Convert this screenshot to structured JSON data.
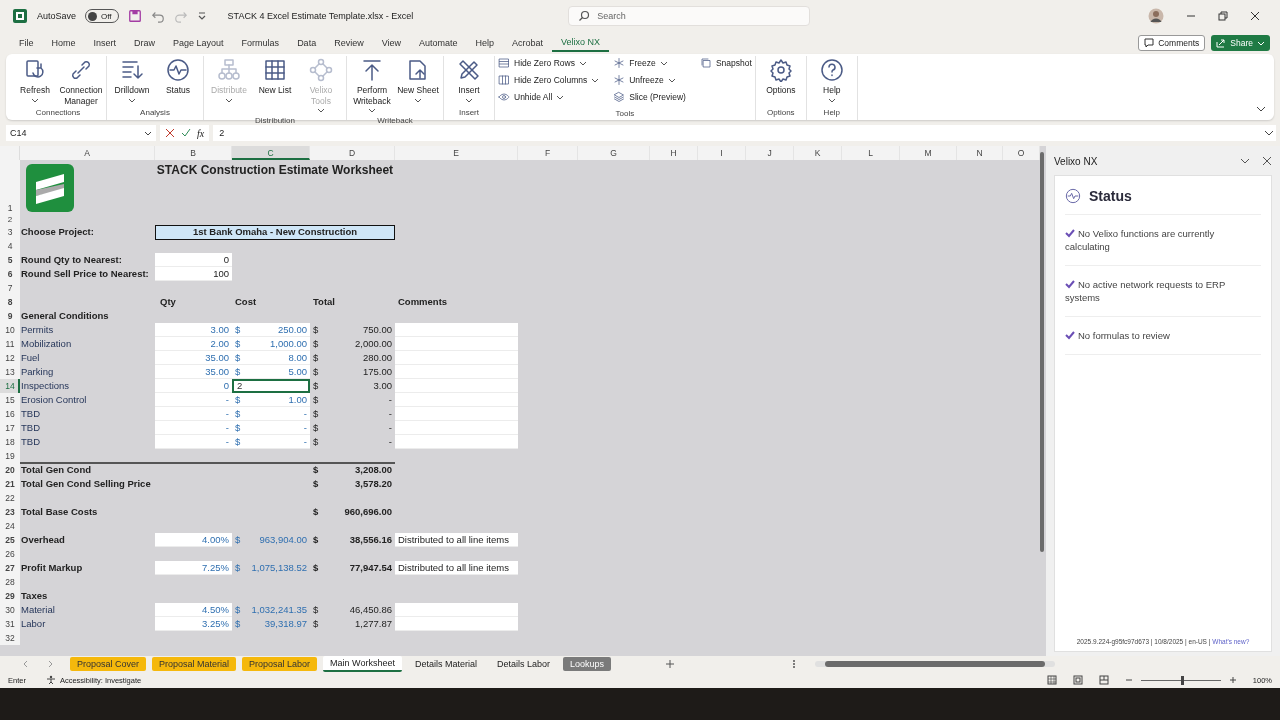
{
  "title_bar": {
    "autosave_label": "AutoSave",
    "autosave": {
      "label": "Off",
      "on": false
    },
    "document_title": "STACK 4 Excel Estimate Template.xlsx  -  Excel",
    "search": {
      "placeholder": "Search"
    }
  },
  "menu_tabs": [
    {
      "label": "File",
      "selected": false
    },
    {
      "label": "Home",
      "selected": false
    },
    {
      "label": "Insert",
      "selected": false
    },
    {
      "label": "Draw",
      "selected": false
    },
    {
      "label": "Page Layout",
      "selected": false
    },
    {
      "label": "Formulas",
      "selected": false
    },
    {
      "label": "Data",
      "selected": false
    },
    {
      "label": "Review",
      "selected": false
    },
    {
      "label": "View",
      "selected": false
    },
    {
      "label": "Automate",
      "selected": false
    },
    {
      "label": "Help",
      "selected": false
    },
    {
      "label": "Acrobat",
      "selected": false
    },
    {
      "label": "Velixo NX",
      "selected": true
    }
  ],
  "actions": {
    "comments": "Comments",
    "share": "Share"
  },
  "ribbon_groups": [
    {
      "label": "Connections",
      "items": [
        {
          "label": "Refresh",
          "kind": "large",
          "dropdown": true,
          "disabled": false
        },
        {
          "label": "Connection Manager",
          "kind": "large",
          "dropdown": false,
          "disabled": false
        }
      ]
    },
    {
      "label": "Analysis",
      "items": [
        {
          "label": "Drilldown",
          "kind": "large",
          "dropdown": true,
          "disabled": false
        },
        {
          "label": "Status",
          "kind": "large",
          "dropdown": false,
          "disabled": false
        }
      ]
    },
    {
      "label": "Distribution",
      "items": [
        {
          "label": "Distribute",
          "kind": "large",
          "dropdown": true,
          "disabled": true
        },
        {
          "label": "New List",
          "kind": "large",
          "dropdown": false,
          "disabled": false
        },
        {
          "label": "Velixo Tools",
          "kind": "large",
          "dropdown": true,
          "disabled": true
        }
      ]
    },
    {
      "label": "Writeback",
      "items": [
        {
          "label": "Perform Writeback",
          "kind": "large",
          "dropdown": true,
          "disabled": false
        },
        {
          "label": "New Sheet",
          "kind": "large",
          "dropdown": true,
          "disabled": false
        }
      ]
    },
    {
      "label": "Insert",
      "items": [
        {
          "label": "Insert",
          "kind": "large",
          "dropdown": true,
          "disabled": false
        }
      ]
    },
    {
      "label": "Tools",
      "items": [
        {
          "label": "Hide Zero Rows",
          "kind": "small",
          "dropdown": true,
          "disabled": false
        },
        {
          "label": "Hide Zero Columns",
          "kind": "small",
          "dropdown": true,
          "disabled": false
        },
        {
          "label": "Unhide All",
          "kind": "small",
          "dropdown": true,
          "disabled": false
        },
        {
          "label": "Freeze",
          "kind": "small",
          "dropdown": true,
          "disabled": false
        },
        {
          "label": "Unfreeze",
          "kind": "small",
          "dropdown": true,
          "disabled": false
        },
        {
          "label": "Slice (Preview)",
          "kind": "small",
          "dropdown": false,
          "disabled": false
        },
        {
          "label": "Snapshot",
          "kind": "small",
          "dropdown": false,
          "disabled": false
        }
      ]
    },
    {
      "label": "Options",
      "items": [
        {
          "label": "Options",
          "kind": "large",
          "dropdown": false,
          "disabled": false
        }
      ]
    },
    {
      "label": "Help",
      "items": [
        {
          "label": "Help",
          "kind": "large",
          "dropdown": true,
          "disabled": false
        }
      ]
    }
  ],
  "formula_bar": {
    "name_box": "C14",
    "function_label": "fx",
    "formula": "2"
  },
  "sheet": {
    "columns": [
      {
        "label": "A",
        "selected": false
      },
      {
        "label": "B",
        "selected": false
      },
      {
        "label": "C",
        "selected": true
      },
      {
        "label": "D",
        "selected": false
      },
      {
        "label": "E",
        "selected": false
      },
      {
        "label": "F",
        "selected": false
      },
      {
        "label": "G",
        "selected": false
      },
      {
        "label": "H",
        "selected": false
      },
      {
        "label": "I",
        "selected": false
      },
      {
        "label": "J",
        "selected": false
      },
      {
        "label": "K",
        "selected": false
      },
      {
        "label": "L",
        "selected": false
      },
      {
        "label": "M",
        "selected": false
      },
      {
        "label": "N",
        "selected": false
      },
      {
        "label": "O",
        "selected": false
      }
    ],
    "rows": [
      {
        "num": "1",
        "selected": false,
        "kind": "logo-title",
        "title": "STACK Construction Estimate Worksheet"
      },
      {
        "num": "2",
        "selected": false,
        "kind": "spacer"
      },
      {
        "num": "3",
        "selected": false,
        "kind": "project",
        "label": "Choose Project:",
        "project": "1st Bank Omaha - New Construction"
      },
      {
        "num": "4",
        "selected": false,
        "kind": "blank"
      },
      {
        "num": "5",
        "selected": false,
        "kind": "setting",
        "label": "Round Qty to Nearest:",
        "qty": "0"
      },
      {
        "num": "6",
        "selected": false,
        "kind": "setting",
        "label": "Round Sell Price to Nearest:",
        "qty": "100"
      },
      {
        "num": "7",
        "selected": false,
        "kind": "blank"
      },
      {
        "num": "8",
        "selected": false,
        "kind": "header",
        "qty_heading": "Qty",
        "cost_heading": "Cost",
        "total_heading": "Total",
        "comment_heading": "Comments"
      },
      {
        "num": "9",
        "selected": false,
        "kind": "section",
        "label": "General Conditions"
      },
      {
        "num": "10",
        "selected": false,
        "kind": "item",
        "label": "Permits",
        "qty": "3.00",
        "cost_cur": "$",
        "cost": "250.00",
        "total_cur": "$",
        "total": "750.00"
      },
      {
        "num": "11",
        "selected": false,
        "kind": "item",
        "label": "Mobilization",
        "qty": "2.00",
        "cost_cur": "$",
        "cost": "1,000.00",
        "total_cur": "$",
        "total": "2,000.00"
      },
      {
        "num": "12",
        "selected": false,
        "kind": "item",
        "label": "Fuel",
        "qty": "35.00",
        "cost_cur": "$",
        "cost": "8.00",
        "total_cur": "$",
        "total": "280.00"
      },
      {
        "num": "13",
        "selected": false,
        "kind": "item",
        "label": "Parking",
        "qty": "35.00",
        "cost_cur": "$",
        "cost": "5.00",
        "total_cur": "$",
        "total": "175.00"
      },
      {
        "num": "14",
        "selected": true,
        "kind": "item",
        "editing": true,
        "label": "Inspections",
        "qty": "0",
        "entry": "2",
        "total_cur": "$",
        "total": "3.00"
      },
      {
        "num": "15",
        "selected": false,
        "kind": "item",
        "label": "Erosion Control",
        "qty": "-",
        "cost_cur": "$",
        "cost": "1.00",
        "total_cur": "$",
        "total": "-"
      },
      {
        "num": "16",
        "selected": false,
        "kind": "item",
        "label": "TBD",
        "qty": "-",
        "cost_cur": "$",
        "cost": "-",
        "total_cur": "$",
        "total": "-"
      },
      {
        "num": "17",
        "selected": false,
        "kind": "item",
        "label": "TBD",
        "qty": "-",
        "cost_cur": "$",
        "cost": "-",
        "total_cur": "$",
        "total": "-"
      },
      {
        "num": "18",
        "selected": false,
        "kind": "item",
        "label": "TBD",
        "qty": "-",
        "cost_cur": "$",
        "cost": "-",
        "total_cur": "$",
        "total": "-"
      },
      {
        "num": "19",
        "selected": false,
        "kind": "blank"
      },
      {
        "num": "20",
        "selected": false,
        "kind": "total",
        "rule_above": true,
        "label": "Total Gen Cond",
        "total_cur": "$",
        "total": "3,208.00"
      },
      {
        "num": "21",
        "selected": false,
        "kind": "total",
        "label": "Total Gen Cond Selling Price",
        "total_cur": "$",
        "total": "3,578.20"
      },
      {
        "num": "22",
        "selected": false,
        "kind": "blank"
      },
      {
        "num": "23",
        "selected": false,
        "kind": "total",
        "label": "Total Base Costs",
        "total_cur": "$",
        "total": "960,696.00"
      },
      {
        "num": "24",
        "selected": false,
        "kind": "blank"
      },
      {
        "num": "25",
        "selected": false,
        "kind": "rate",
        "label": "Overhead",
        "qty": "4.00%",
        "cost_cur": "$",
        "cost": "963,904.00",
        "total_cur": "$",
        "total": "38,556.16",
        "comment": "Distributed to all line items"
      },
      {
        "num": "26",
        "selected": false,
        "kind": "blank"
      },
      {
        "num": "27",
        "selected": false,
        "kind": "rate",
        "label": "Profit Markup",
        "qty": "7.25%",
        "cost_cur": "$",
        "cost": "1,075,138.52",
        "total_cur": "$",
        "total": "77,947.54",
        "comment": "Distributed to all line items"
      },
      {
        "num": "28",
        "selected": false,
        "kind": "blank"
      },
      {
        "num": "29",
        "selected": false,
        "kind": "section",
        "label": "Taxes"
      },
      {
        "num": "30",
        "selected": false,
        "kind": "tax",
        "label": "Material",
        "qty": "4.50%",
        "cost_cur": "$",
        "cost": "1,032,241.35",
        "total_cur": "$",
        "total": "46,450.86"
      },
      {
        "num": "31",
        "selected": false,
        "kind": "tax",
        "label": "Labor",
        "qty": "3.25%",
        "cost_cur": "$",
        "cost": "39,318.97",
        "total_cur": "$",
        "total": "1,277.87"
      },
      {
        "num": "32",
        "selected": false,
        "kind": "blank"
      }
    ]
  },
  "sheet_tabs": [
    {
      "label": "Proposal Cover",
      "selected": false,
      "color": "#f5b80c"
    },
    {
      "label": "Proposal Material",
      "selected": false,
      "color": "#f5b80c"
    },
    {
      "label": "Proposal Labor",
      "selected": false,
      "color": "#f5b80c"
    },
    {
      "label": "Main Worksheet",
      "selected": true
    },
    {
      "label": "Details Material",
      "selected": false
    },
    {
      "label": "Details Labor",
      "selected": false
    },
    {
      "label": "Lookups",
      "selected": false,
      "color": "#7a7a7a"
    }
  ],
  "side_pane": {
    "title": "Velixo NX",
    "heading": "Status",
    "messages": [
      "No Velixo functions are currently calculating",
      "No active network requests to ERP systems",
      "No formulas to review"
    ],
    "footer": "2025.9.224-g95fc97d673 | 10/8/2025 | en-US |",
    "footer_link": "What's new?"
  },
  "status_bar": {
    "mode": "Enter",
    "accessibility": "Accessibility: Investigate",
    "zoom": {
      "level": 0.5
    },
    "zoom_label": "100%"
  }
}
